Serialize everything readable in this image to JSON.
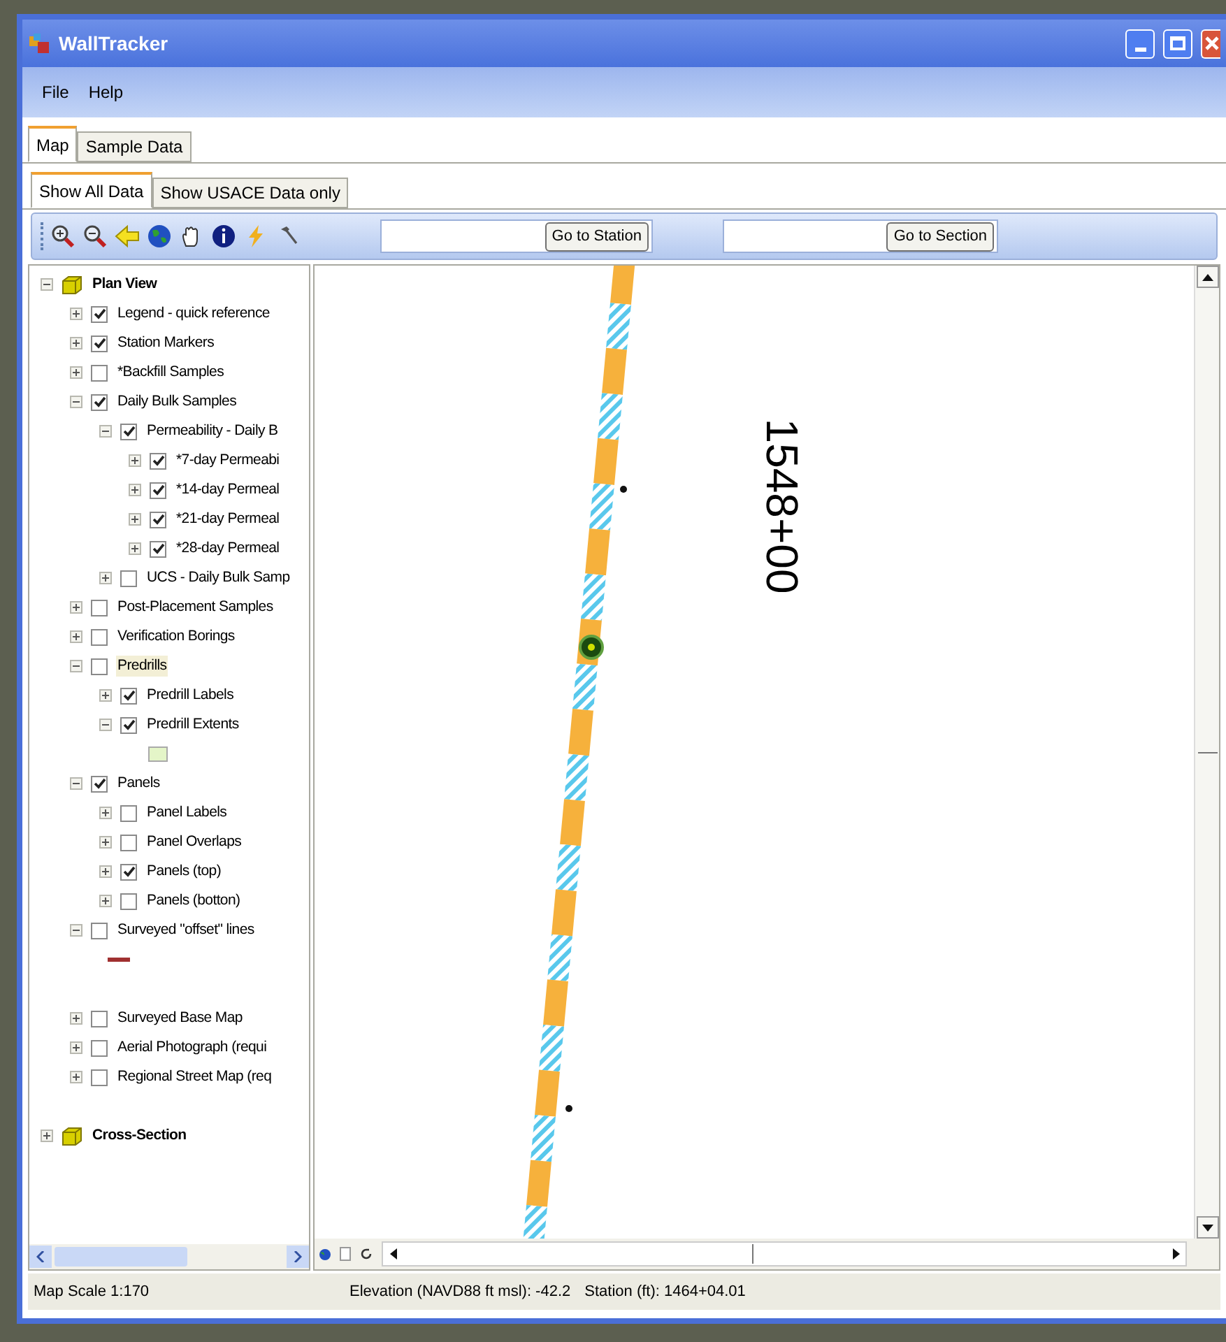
{
  "window": {
    "title": "WallTracker"
  },
  "menu": [
    "File",
    "Help"
  ],
  "tabs": [
    {
      "label": "Map",
      "selected": true
    },
    {
      "label": "Sample Data",
      "selected": false
    }
  ],
  "subtabs": [
    {
      "label": "Show All Data",
      "selected": true
    },
    {
      "label": "Show USACE Data only",
      "selected": false
    }
  ],
  "toolbar": {
    "station_button": "Go to Station",
    "section_button": "Go to Section"
  },
  "tree": [
    {
      "kind": "group",
      "label": "Plan View",
      "expanded": true,
      "children": [
        {
          "kind": "layer",
          "label": "Legend - quick reference",
          "checked": true,
          "expanded": false,
          "selected": false
        },
        {
          "kind": "layer",
          "label": "Station Markers",
          "checked": true,
          "expanded": false,
          "selected": false
        },
        {
          "kind": "layer",
          "label": "*Backfill Samples",
          "checked": false,
          "expanded": false,
          "selected": false
        },
        {
          "kind": "layer",
          "label": "Daily Bulk Samples",
          "checked": true,
          "expanded": true,
          "selected": false,
          "children": [
            {
              "kind": "layer",
              "label": "Permeability - Daily B",
              "checked": true,
              "expanded": true,
              "selected": false,
              "children": [
                {
                  "kind": "layer",
                  "label": "*7-day Permeabi",
                  "checked": true,
                  "expanded": false,
                  "selected": false
                },
                {
                  "kind": "layer",
                  "label": "*14-day Permeal",
                  "checked": true,
                  "expanded": false,
                  "selected": false
                },
                {
                  "kind": "layer",
                  "label": "*21-day Permeal",
                  "checked": true,
                  "expanded": false,
                  "selected": false
                },
                {
                  "kind": "layer",
                  "label": "*28-day Permeal",
                  "checked": true,
                  "expanded": false,
                  "selected": false
                }
              ]
            },
            {
              "kind": "layer",
              "label": "UCS - Daily Bulk Samp",
              "checked": false,
              "expanded": false,
              "selected": false
            }
          ]
        },
        {
          "kind": "layer",
          "label": "Post-Placement Samples",
          "checked": false,
          "expanded": false,
          "selected": false
        },
        {
          "kind": "layer",
          "label": "Verification Borings",
          "checked": false,
          "expanded": false,
          "selected": false
        },
        {
          "kind": "layer",
          "label": "Predrills",
          "checked": false,
          "expanded": true,
          "selected": true,
          "children": [
            {
              "kind": "layer",
              "label": "Predrill Labels",
              "checked": true,
              "expanded": false,
              "selected": false
            },
            {
              "kind": "layer",
              "label": "Predrill Extents",
              "checked": true,
              "expanded": true,
              "selected": false,
              "children": [
                {
                  "kind": "swatch",
                  "color": "#e4f5c8"
                }
              ]
            }
          ]
        },
        {
          "kind": "layer",
          "label": "Panels",
          "checked": true,
          "expanded": true,
          "selected": false,
          "children": [
            {
              "kind": "layer",
              "label": "Panel Labels",
              "checked": false,
              "expanded": false,
              "selected": false
            },
            {
              "kind": "layer",
              "label": "Panel Overlaps",
              "checked": false,
              "expanded": false,
              "selected": false
            },
            {
              "kind": "layer",
              "label": "Panels (top)",
              "checked": true,
              "expanded": false,
              "selected": false
            },
            {
              "kind": "layer",
              "label": "Panels (botton)",
              "checked": false,
              "expanded": false,
              "selected": false
            }
          ]
        },
        {
          "kind": "layer",
          "label": "Surveyed \"offset\" lines",
          "checked": false,
          "expanded": true,
          "selected": false,
          "children": [
            {
              "kind": "line",
              "color": "#a03030"
            }
          ]
        },
        {
          "kind": "spacer"
        },
        {
          "kind": "layer",
          "label": "Surveyed Base Map",
          "checked": false,
          "expanded": false,
          "selected": false
        },
        {
          "kind": "layer",
          "label": "Aerial Photograph (requi",
          "checked": false,
          "expanded": false,
          "selected": false
        },
        {
          "kind": "layer",
          "label": "Regional Street Map (req",
          "checked": false,
          "expanded": false,
          "selected": false
        }
      ]
    },
    {
      "kind": "spacer"
    },
    {
      "kind": "group",
      "label": "Cross-Section",
      "expanded": false
    }
  ],
  "map": {
    "station_label": "1548+00"
  },
  "status_bar": {
    "scale": "Map Scale 1:170",
    "elevation": "Elevation (NAVD88 ft msl): -42.2",
    "station": "Station (ft): 1464+04.01"
  }
}
